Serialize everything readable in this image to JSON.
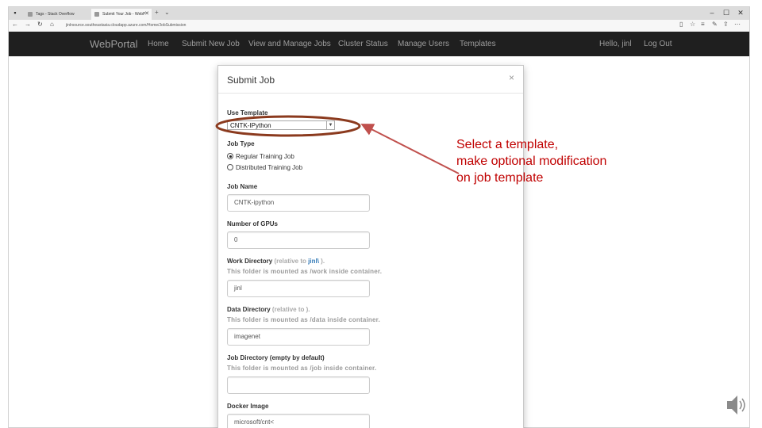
{
  "browser": {
    "tabs": [
      {
        "title": "Tags - Stack Overflow"
      },
      {
        "title": "Submit Your Job - WebP"
      }
    ],
    "new_tab": "+",
    "tab_dropdown": "⌄",
    "url": "jinlrsource.southeastasia.cloudapp.azure.com/Home/JobSubmission"
  },
  "navbar": {
    "brand": "WebPortal",
    "links": [
      "Home",
      "Submit New Job",
      "View and Manage Jobs",
      "Cluster Status",
      "Manage Users",
      "Templates"
    ],
    "user_greeting": "Hello, jinl",
    "logout": "Log Out"
  },
  "modal": {
    "title": "Submit Job",
    "close": "×",
    "use_template_label": "Use Template",
    "template_selected": "CNTK-IPython",
    "job_type_label": "Job Type",
    "job_type_options": [
      {
        "label": "Regular Training Job",
        "checked": true
      },
      {
        "label": "Distributed Training Job",
        "checked": false
      }
    ],
    "job_name_label": "Job Name",
    "job_name_value": "CNTK-ipython",
    "num_gpus_label": "Number of GPUs",
    "num_gpus_value": "0",
    "work_dir_label": "Work Directory",
    "work_dir_hint_prefix": "(relative to",
    "work_dir_hint_link": "jinl\\",
    "work_dir_hint_suffix": ").",
    "work_dir_help": "This folder is mounted as /work inside container.",
    "work_dir_value": "jinl",
    "data_dir_label": "Data Directory",
    "data_dir_hint": "(relative to ).",
    "data_dir_help": "This folder is mounted as /data inside container.",
    "data_dir_value": "imagenet",
    "job_dir_label": "Job Directory (empty by default)",
    "job_dir_help": "This folder is mounted as /job inside container.",
    "job_dir_value": "",
    "docker_image_label": "Docker Image",
    "docker_image_value": "microsoft/cnt<"
  },
  "annotation": {
    "text": "Select a template,\nmake optional modification\non job template",
    "color": "#c00000",
    "ellipse_color": "#8b3a1e",
    "arrow_color": "#c0504d"
  },
  "icons": {
    "back": "back-arrow-icon",
    "forward": "forward-arrow-icon",
    "refresh": "refresh-icon",
    "home": "home-icon",
    "favorite": "star-icon",
    "speaker": "speaker-icon"
  }
}
